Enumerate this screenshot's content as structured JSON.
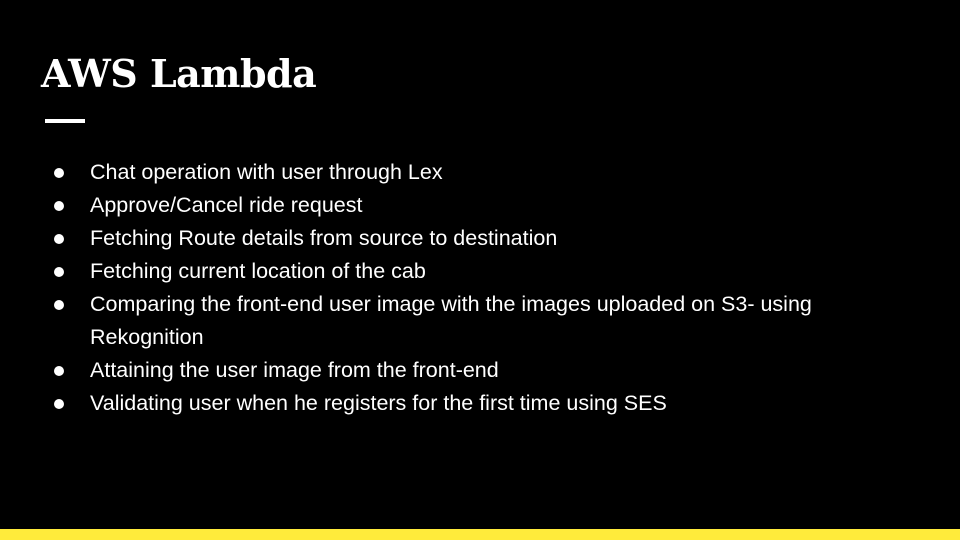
{
  "slide": {
    "title": "AWS Lambda",
    "bullets": [
      "Chat operation with user through Lex",
      "Approve/Cancel ride request",
      "Fetching Route details from source to destination",
      "Fetching current location of the cab",
      "Comparing the front-end user image with the images uploaded on S3- using Rekognition",
      "Attaining the user image from the front-end",
      "Validating user when he registers for the first time using SES"
    ]
  },
  "colors": {
    "background": "#000000",
    "text": "#ffffff",
    "accent_bar": "#ffeb3b"
  }
}
